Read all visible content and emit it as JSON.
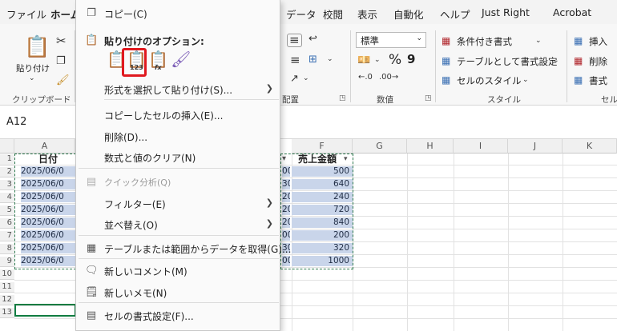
{
  "menubar": {
    "tabs": [
      "ファイル",
      "ホーム",
      "データ",
      "校閲",
      "表示",
      "自動化",
      "ヘルプ",
      "Just Right",
      "Acrobat"
    ]
  },
  "ribbon": {
    "clipboard_label": "クリップボード",
    "paste_label": "貼り付け",
    "alignment_label": "配置",
    "number_label": "数値",
    "style_label": "スタイル",
    "cells_label": "セル",
    "number_format_value": "標準",
    "conditional_format": "条件付き書式",
    "format_as_table": "テーブルとして書式設定",
    "cell_styles": "セルのスタイル",
    "insert": "挿入",
    "delete": "削除",
    "format": "書式",
    "percent": "%",
    "comma": "9"
  },
  "namebox": {
    "value": "A12"
  },
  "columns": [
    "A",
    "F",
    "G",
    "H",
    "I",
    "J",
    "K"
  ],
  "headers": {
    "a1": "日付",
    "f1": "売上金額"
  },
  "rows": [
    "1",
    "2",
    "3",
    "4",
    "5",
    "6",
    "7",
    "8",
    "9",
    "10",
    "11",
    "12",
    "13"
  ],
  "col_a_values": [
    "2025/06/0",
    "2025/06/0",
    "2025/06/0",
    "2025/06/0",
    "2025/06/0",
    "2025/06/0",
    "2025/06/0",
    "2025/06/0"
  ],
  "col_e_values": [
    "00",
    "30",
    "20",
    "20",
    "20",
    "00",
    "30",
    "00"
  ],
  "col_f_values": [
    "500",
    "640",
    "240",
    "720",
    "840",
    "200",
    "320",
    "1000"
  ],
  "context_menu": {
    "copy": "コピー(C)",
    "paste_options_title": "貼り付けのオプション:",
    "paste_special": "形式を選択して貼り付け(S)...",
    "insert_copied": "コピーしたセルの挿入(E)...",
    "delete": "削除(D)...",
    "clear": "数式と値のクリア(N)",
    "quick_analysis": "クイック分析(Q)",
    "filter": "フィルター(E)",
    "sort": "並べ替え(O)",
    "get_data": "テーブルまたは範囲からデータを取得(G)...",
    "new_comment": "新しいコメント(M)",
    "new_note": "新しいメモ(N)",
    "format_cells": "セルの書式設定(F)...",
    "paste_values_badge": "123",
    "paste_formula_badge": "fx"
  },
  "colors": {
    "accent": "#107c41",
    "highlight_frame": "#e0191f",
    "selection": "#c9d5ea"
  }
}
